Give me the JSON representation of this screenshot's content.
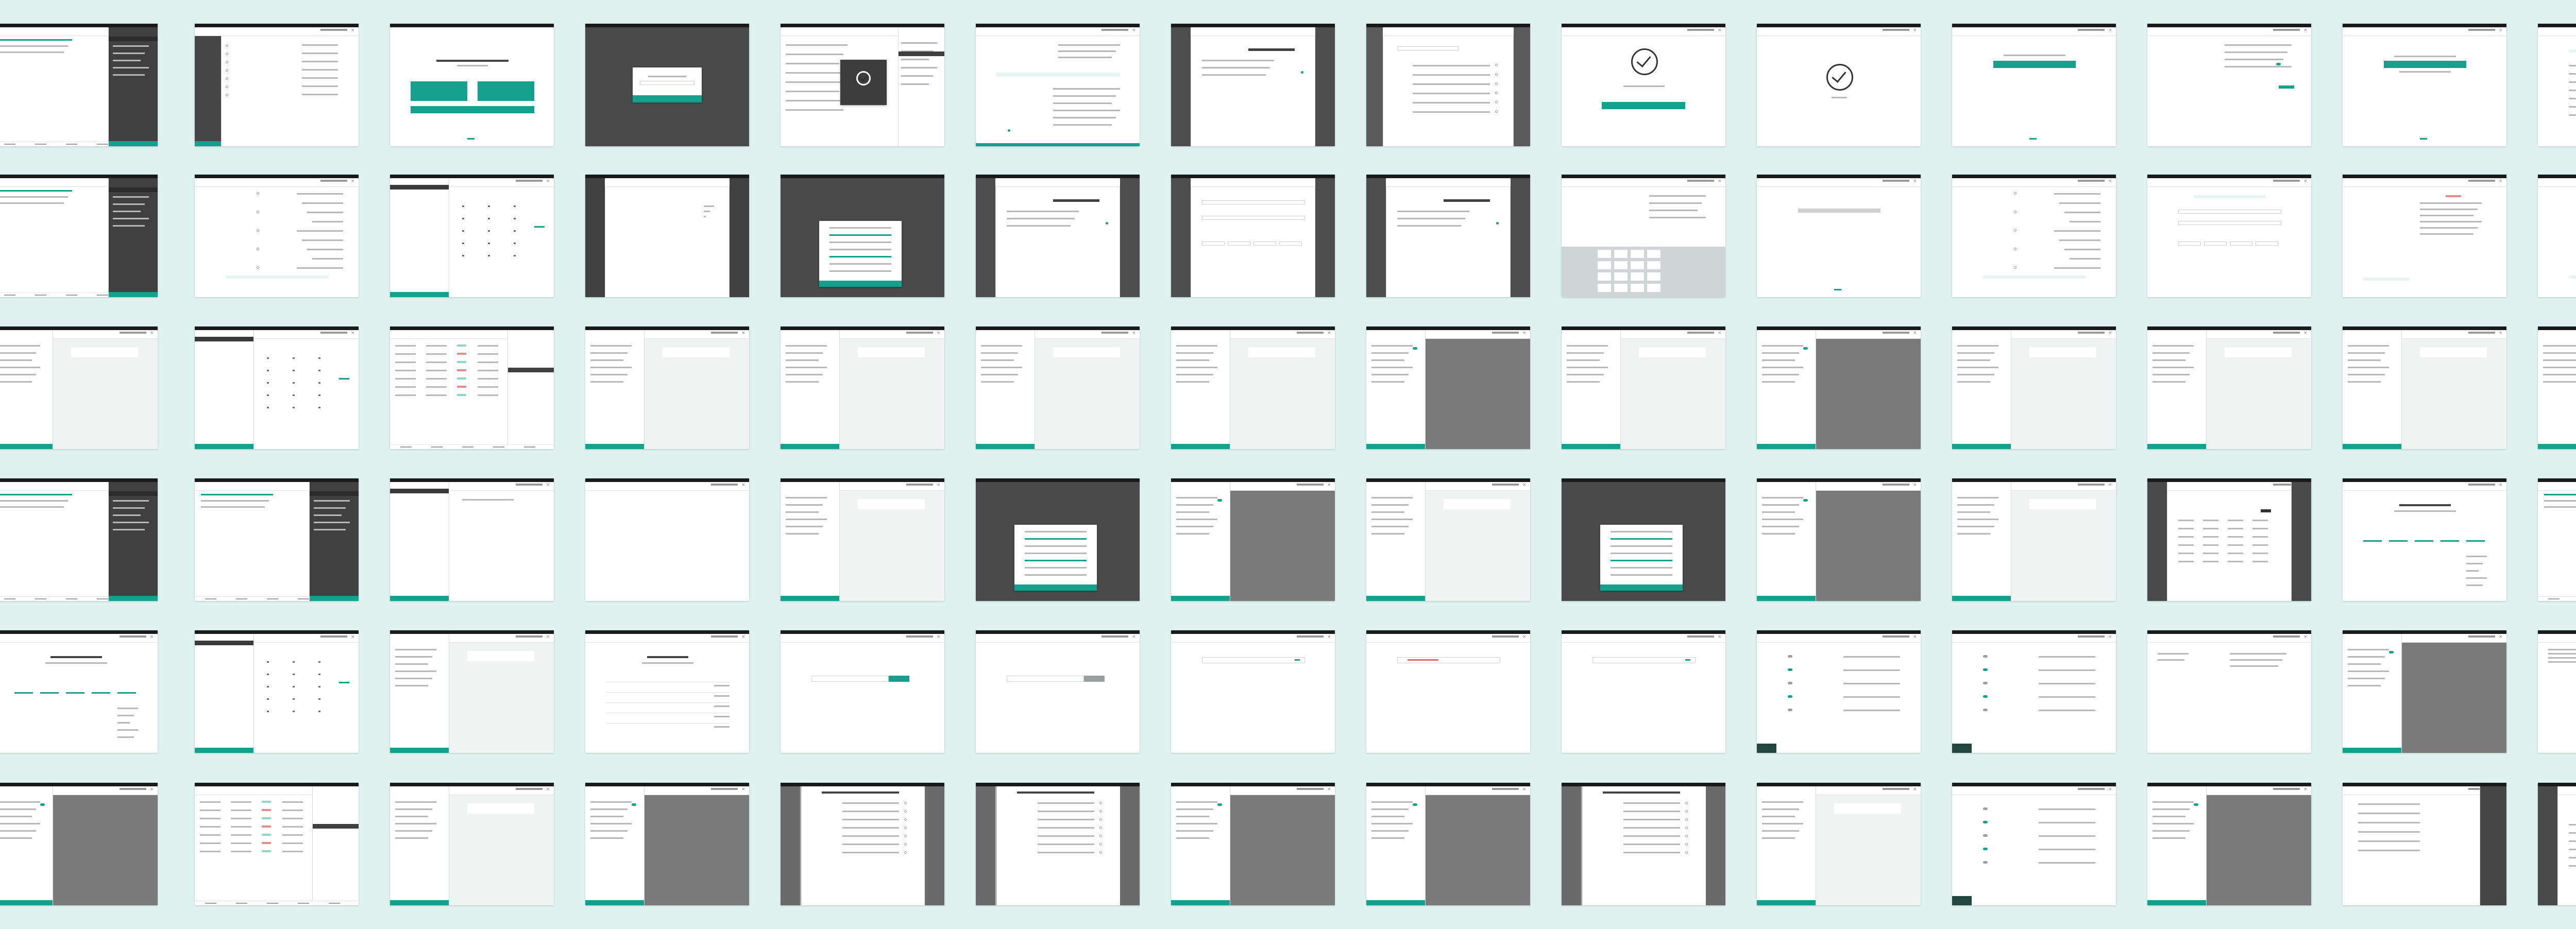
{
  "board": {
    "background": "#dff2ef",
    "accent": "#13a08c",
    "rows": 6,
    "columns": 14
  },
  "screens": [
    {
      "kind": "list-dark-side"
    },
    {
      "kind": "settings-list-dark-left"
    },
    {
      "kind": "three-buttons-dialog"
    },
    {
      "kind": "modal-on-dark"
    },
    {
      "kind": "loading-overlay"
    },
    {
      "kind": "form-radio"
    },
    {
      "kind": "form-dark-sides"
    },
    {
      "kind": "filters-dark-sides"
    },
    {
      "kind": "success-check-button"
    },
    {
      "kind": "success-check"
    },
    {
      "kind": "single-button"
    },
    {
      "kind": "toggle-form"
    },
    {
      "kind": "single-button-wide"
    },
    {
      "kind": "list-teal-link"
    },
    {
      "kind": "list-dark-side"
    },
    {
      "kind": "settings-list"
    },
    {
      "kind": "keypad"
    },
    {
      "kind": "dark-sides-blank"
    },
    {
      "kind": "menu-dialog-dark"
    },
    {
      "kind": "form-dark-sides"
    },
    {
      "kind": "form-dark-sides-inputs"
    },
    {
      "kind": "form-dark-sides"
    },
    {
      "kind": "keyboard"
    },
    {
      "kind": "grey-card"
    },
    {
      "kind": "settings-list"
    },
    {
      "kind": "form-inputs"
    },
    {
      "kind": "detail-red"
    },
    {
      "kind": "settings-list"
    },
    {
      "kind": "list-grey"
    },
    {
      "kind": "keypad"
    },
    {
      "kind": "table-pills"
    },
    {
      "kind": "list-grey"
    },
    {
      "kind": "list-grey"
    },
    {
      "kind": "list-grey"
    },
    {
      "kind": "list-grey"
    },
    {
      "kind": "list-grey-dark"
    },
    {
      "kind": "list-grey"
    },
    {
      "kind": "list-grey-dark"
    },
    {
      "kind": "list-grey"
    },
    {
      "kind": "list-grey"
    },
    {
      "kind": "list-grey"
    },
    {
      "kind": "list-grey"
    },
    {
      "kind": "list-dark-side"
    },
    {
      "kind": "list-dark-side"
    },
    {
      "kind": "keypad-side"
    },
    {
      "kind": "blank"
    },
    {
      "kind": "list-grey"
    },
    {
      "kind": "menu-dialog-dark"
    },
    {
      "kind": "list-grey-dark"
    },
    {
      "kind": "list-grey"
    },
    {
      "kind": "menu-dialog-dark"
    },
    {
      "kind": "list-grey-dark"
    },
    {
      "kind": "list-grey"
    },
    {
      "kind": "table-dark"
    },
    {
      "kind": "centered-links"
    },
    {
      "kind": "list-dark-side"
    },
    {
      "kind": "centered-links"
    },
    {
      "kind": "keypad"
    },
    {
      "kind": "list-grey"
    },
    {
      "kind": "centered-list"
    },
    {
      "kind": "search-input"
    },
    {
      "kind": "search-input-grey"
    },
    {
      "kind": "input-row"
    },
    {
      "kind": "input-row-red"
    },
    {
      "kind": "input-row"
    },
    {
      "kind": "toggles-dark-bottom"
    },
    {
      "kind": "toggles-dark-bottom"
    },
    {
      "kind": "two-column-text"
    },
    {
      "kind": "list-grey-dark"
    },
    {
      "kind": "paragraph"
    },
    {
      "kind": "list-grey-dark"
    },
    {
      "kind": "table-pills"
    },
    {
      "kind": "list-grey"
    },
    {
      "kind": "list-grey-dark"
    },
    {
      "kind": "radio-list-dark"
    },
    {
      "kind": "radio-list-dark"
    },
    {
      "kind": "list-grey-dark"
    },
    {
      "kind": "list-grey-dark"
    },
    {
      "kind": "radio-list-dark"
    },
    {
      "kind": "list-grey"
    },
    {
      "kind": "toggles-dark-bottom"
    },
    {
      "kind": "list-grey-dark"
    },
    {
      "kind": "settings-list-dark-right"
    },
    {
      "kind": "table-dark"
    }
  ]
}
